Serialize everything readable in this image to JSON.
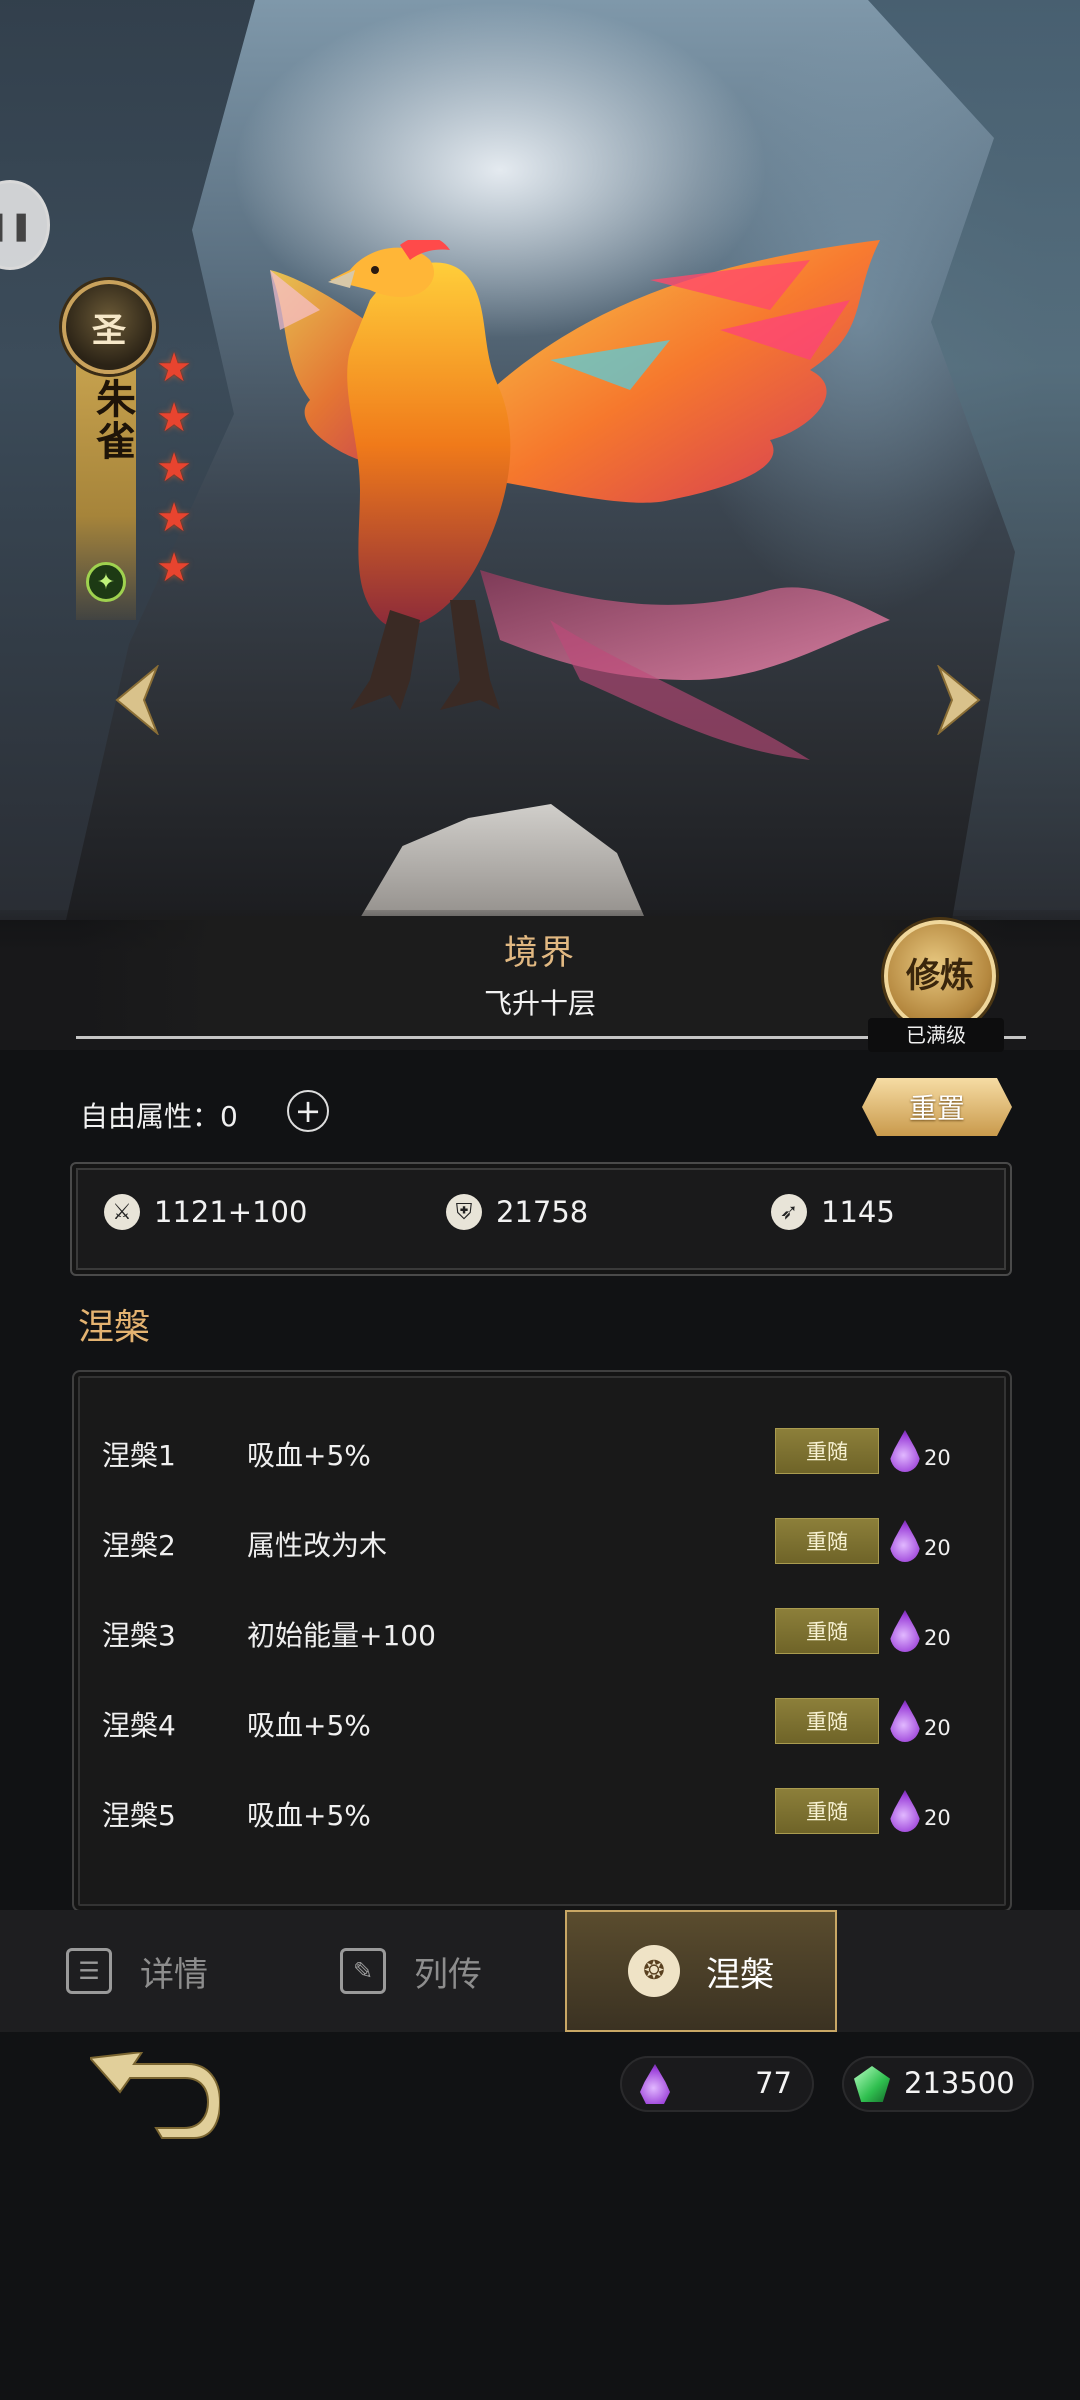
{
  "hero": {
    "rank_badge": "圣",
    "name": "朱雀",
    "stars": 5,
    "element_icon": "wood-leaf-icon"
  },
  "realm": {
    "title": "境界",
    "value": "飞升十层",
    "cultivate_label": "修炼",
    "maxed_label": "已满级"
  },
  "attributes": {
    "free_label": "自由属性：",
    "free_value": "0",
    "reset_label": "重置",
    "attack": "1121+100",
    "defense": "21758",
    "speed": "1145"
  },
  "nirvana": {
    "section_title": "涅槃",
    "reroll_label": "重随",
    "rows": [
      {
        "name": "涅槃1",
        "effect": "吸血+5%",
        "cost": "20"
      },
      {
        "name": "涅槃2",
        "effect": "属性改为木",
        "cost": "20"
      },
      {
        "name": "涅槃3",
        "effect": "初始能量+100",
        "cost": "20"
      },
      {
        "name": "涅槃4",
        "effect": "吸血+5%",
        "cost": "20"
      },
      {
        "name": "涅槃5",
        "effect": "吸血+5%",
        "cost": "20"
      }
    ]
  },
  "tabs": [
    {
      "label": "详情",
      "icon": "details-list-icon",
      "active": false
    },
    {
      "label": "列传",
      "icon": "biography-icon",
      "active": false
    },
    {
      "label": "涅槃",
      "icon": "phoenix-emblem-icon",
      "active": true
    }
  ],
  "currencies": {
    "essence": "77",
    "jade": "213500"
  },
  "colors": {
    "gold_accent": "#e4b371",
    "star_red": "#e8442f",
    "reroll_button": "#7d7131",
    "essence_purple": "#9b3fd9",
    "jade_green": "#4fd66a"
  }
}
